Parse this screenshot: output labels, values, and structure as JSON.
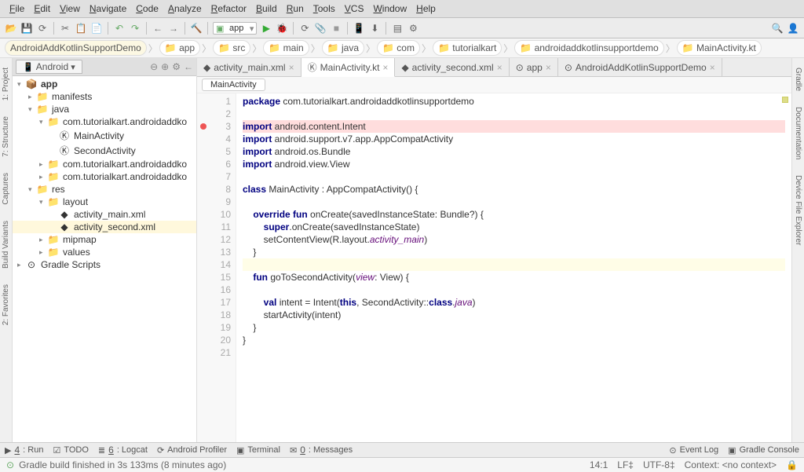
{
  "menu": [
    "File",
    "Edit",
    "View",
    "Navigate",
    "Code",
    "Analyze",
    "Refactor",
    "Build",
    "Run",
    "Tools",
    "VCS",
    "Window",
    "Help"
  ],
  "toolbar": {
    "run_config": "app"
  },
  "breadcrumbs": [
    "AndroidAddKotlinSupportDemo",
    "app",
    "src",
    "main",
    "java",
    "com",
    "tutorialkart",
    "androidaddkotlinsupportdemo",
    "MainActivity.kt"
  ],
  "project": {
    "tab": "Android",
    "tree": [
      {
        "d": 0,
        "a": "▾",
        "i": "📦",
        "t": "app",
        "b": true
      },
      {
        "d": 1,
        "a": "▸",
        "i": "📁",
        "t": "manifests"
      },
      {
        "d": 1,
        "a": "▾",
        "i": "📁",
        "t": "java"
      },
      {
        "d": 2,
        "a": "▾",
        "i": "📁",
        "t": "com.tutorialkart.androidaddko"
      },
      {
        "d": 3,
        "a": "",
        "i": "Ⓚ",
        "t": "MainActivity"
      },
      {
        "d": 3,
        "a": "",
        "i": "Ⓚ",
        "t": "SecondActivity"
      },
      {
        "d": 2,
        "a": "▸",
        "i": "📁",
        "t": "com.tutorialkart.androidaddko"
      },
      {
        "d": 2,
        "a": "▸",
        "i": "📁",
        "t": "com.tutorialkart.androidaddko"
      },
      {
        "d": 1,
        "a": "▾",
        "i": "📁",
        "t": "res"
      },
      {
        "d": 2,
        "a": "▾",
        "i": "📁",
        "t": "layout"
      },
      {
        "d": 3,
        "a": "",
        "i": "◆",
        "t": "activity_main.xml"
      },
      {
        "d": 3,
        "a": "",
        "i": "◆",
        "t": "activity_second.xml",
        "sel": true
      },
      {
        "d": 2,
        "a": "▸",
        "i": "📁",
        "t": "mipmap"
      },
      {
        "d": 2,
        "a": "▸",
        "i": "📁",
        "t": "values"
      },
      {
        "d": 0,
        "a": "▸",
        "i": "⊙",
        "t": "Gradle Scripts"
      }
    ]
  },
  "sidebarLeft": [
    "1: Project",
    "7: Structure",
    "Captures",
    "Build Variants",
    "2: Favorites"
  ],
  "sidebarRight": [
    "Gradle",
    "Documentation",
    "Device File Explorer"
  ],
  "editorTabs": [
    {
      "icon": "◆",
      "label": "activity_main.xml",
      "active": false
    },
    {
      "icon": "Ⓚ",
      "label": "MainActivity.kt",
      "active": true
    },
    {
      "icon": "◆",
      "label": "activity_second.xml",
      "active": false
    },
    {
      "icon": "⊙",
      "label": "app",
      "active": false
    },
    {
      "icon": "⊙",
      "label": "AndroidAddKotlinSupportDemo",
      "active": false
    }
  ],
  "classCrumb": "MainActivity",
  "code": {
    "lines": [
      {
        "n": 1,
        "tokens": [
          {
            "c": "kw",
            "t": "package"
          },
          {
            "t": " com.tutorialkart.androidaddkotlinsupportdemo"
          }
        ]
      },
      {
        "n": 2,
        "tokens": []
      },
      {
        "n": 3,
        "err": true,
        "mark": true,
        "tokens": [
          {
            "c": "kw",
            "t": "import"
          },
          {
            "t": " android.content.Intent"
          }
        ]
      },
      {
        "n": 4,
        "tokens": [
          {
            "c": "kw",
            "t": "import"
          },
          {
            "t": " android.support.v7.app.AppCompatActivity"
          }
        ]
      },
      {
        "n": 5,
        "tokens": [
          {
            "c": "kw",
            "t": "import"
          },
          {
            "t": " android.os.Bundle"
          }
        ]
      },
      {
        "n": 6,
        "tokens": [
          {
            "c": "kw",
            "t": "import"
          },
          {
            "t": " android.view.View"
          }
        ]
      },
      {
        "n": 7,
        "tokens": []
      },
      {
        "n": 8,
        "tokens": [
          {
            "c": "kw",
            "t": "class"
          },
          {
            "t": " MainActivity : AppCompatActivity() {"
          }
        ]
      },
      {
        "n": 9,
        "tokens": []
      },
      {
        "n": 10,
        "tokens": [
          {
            "t": "    "
          },
          {
            "c": "kw",
            "t": "override fun"
          },
          {
            "t": " onCreate(savedInstanceState: Bundle?) {"
          }
        ]
      },
      {
        "n": 11,
        "tokens": [
          {
            "t": "        "
          },
          {
            "c": "kw",
            "t": "super"
          },
          {
            "t": ".onCreate(savedInstanceState)"
          }
        ]
      },
      {
        "n": 12,
        "tokens": [
          {
            "t": "        setContentView(R.layout."
          },
          {
            "c": "ident",
            "t": "activity_main"
          },
          {
            "t": ")"
          }
        ]
      },
      {
        "n": 13,
        "tokens": [
          {
            "t": "    }"
          }
        ]
      },
      {
        "n": 14,
        "hl": true,
        "tokens": []
      },
      {
        "n": 15,
        "tokens": [
          {
            "t": "    "
          },
          {
            "c": "kw",
            "t": "fun"
          },
          {
            "t": " goToSecondActivity("
          },
          {
            "c": "ident",
            "t": "view"
          },
          {
            "t": ": View) {"
          }
        ]
      },
      {
        "n": 16,
        "tokens": []
      },
      {
        "n": 17,
        "tokens": [
          {
            "t": "        "
          },
          {
            "c": "kw",
            "t": "val"
          },
          {
            "t": " intent = Intent("
          },
          {
            "c": "kw",
            "t": "this"
          },
          {
            "t": ", SecondActivity::"
          },
          {
            "c": "kw",
            "t": "class"
          },
          {
            "t": "."
          },
          {
            "c": "ident",
            "t": "java"
          },
          {
            "t": ")"
          }
        ]
      },
      {
        "n": 18,
        "tokens": [
          {
            "t": "        startActivity(intent)"
          }
        ]
      },
      {
        "n": 19,
        "tokens": [
          {
            "t": "    }"
          }
        ]
      },
      {
        "n": 20,
        "tokens": [
          {
            "t": "}"
          }
        ]
      },
      {
        "n": 21,
        "tokens": []
      }
    ]
  },
  "bottomTabs": {
    "left": [
      {
        "icon": "▶",
        "label": "4: Run",
        "u": true
      },
      {
        "icon": "☑",
        "label": "TODO"
      },
      {
        "icon": "≣",
        "label": "6: Logcat",
        "u": true
      },
      {
        "icon": "⟳",
        "label": "Android Profiler"
      },
      {
        "icon": "▣",
        "label": "Terminal"
      },
      {
        "icon": "✉",
        "label": "0: Messages",
        "u": true
      }
    ],
    "right": [
      {
        "icon": "⊙",
        "label": "Event Log"
      },
      {
        "icon": "▣",
        "label": "Gradle Console"
      }
    ]
  },
  "status": {
    "msg": "Gradle build finished in 3s 133ms (8 minutes ago)",
    "pos": "14:1",
    "enc1": "LF‡",
    "enc2": "UTF-8‡",
    "ctx": "Context: <no context>"
  }
}
